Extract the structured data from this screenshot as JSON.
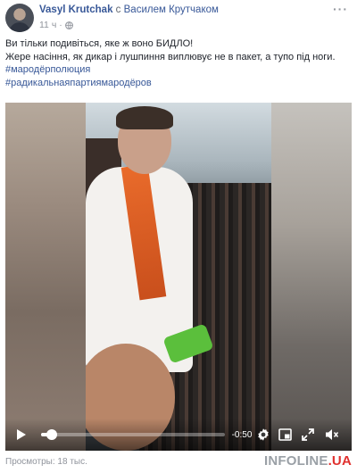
{
  "post": {
    "author": "Vasyl Krutchak",
    "with_word": "с",
    "tagged": "Василем Крутчаком",
    "time": "11 ч",
    "separator": "·",
    "more": "···",
    "text_lines": [
      "Ви тільки подивіться, яке ж воно БИДЛО!",
      "Жере насіння, як дикар і лушпиння виплювує не в пакет, а тупо під ноги."
    ],
    "hashtags": [
      "#мародёрполюция",
      "#радикальнаяпартиямародёров"
    ]
  },
  "video": {
    "time_remaining": "-0:50",
    "progress": 0.06
  },
  "footer": {
    "views": "Просмотры: 18 тыс."
  },
  "watermark": {
    "name": "INFOLINE",
    "tld": ".UA"
  },
  "icons": {
    "play": "play-icon",
    "settings": "gear-icon",
    "pip": "picture-in-picture-icon",
    "fullscreen": "fullscreen-icon",
    "volume": "volume-icon",
    "privacy": "globe-icon"
  }
}
